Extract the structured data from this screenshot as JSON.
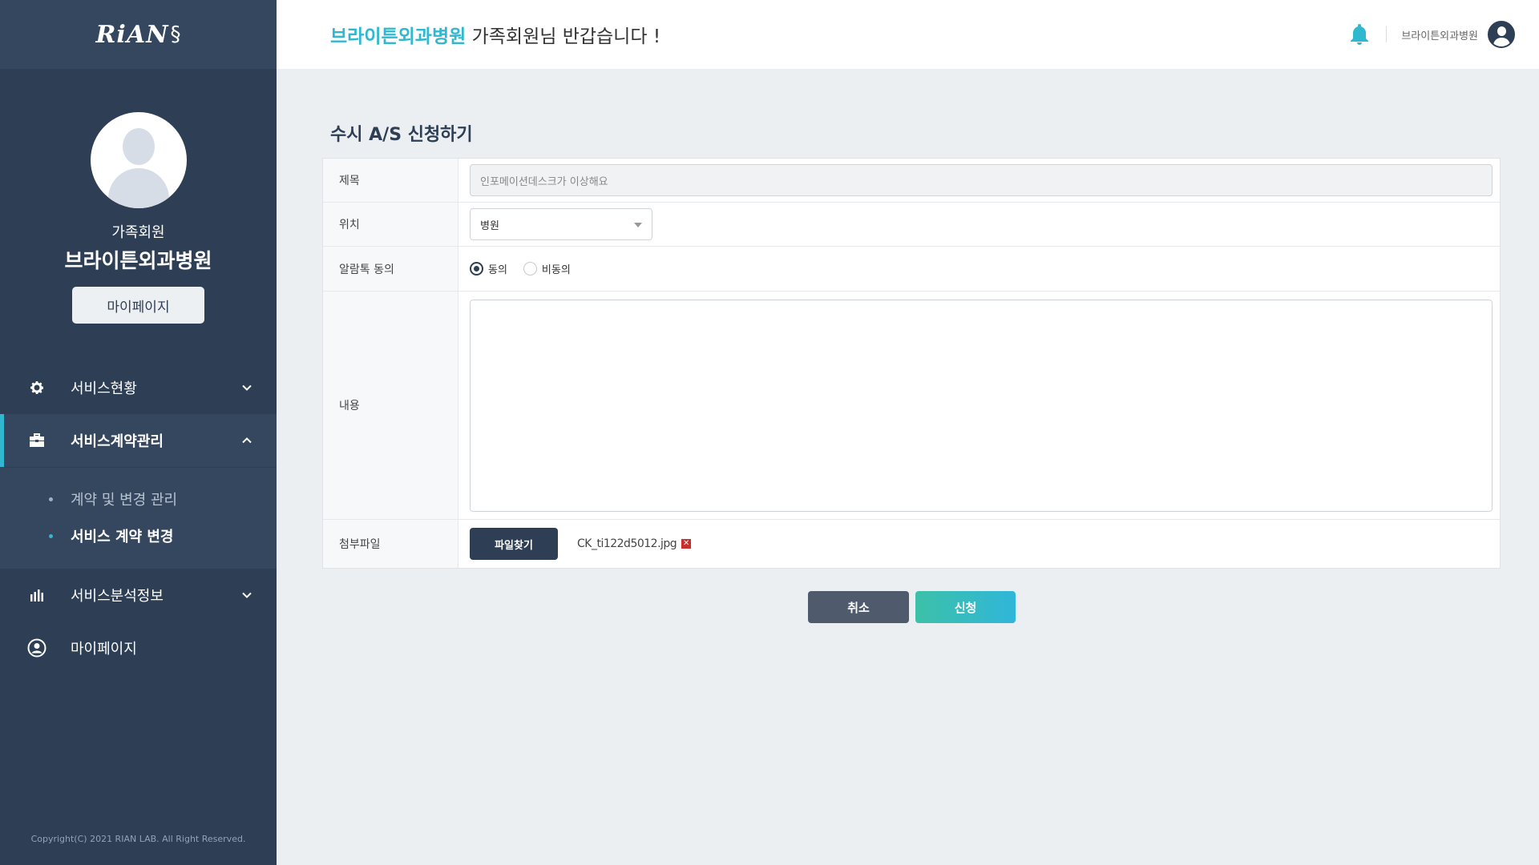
{
  "sidebar": {
    "logo": "RiAN",
    "member_type": "가족회원",
    "hospital_name": "브라이튼외과병원",
    "mypage_button": "마이페이지",
    "menu": [
      {
        "label": "서비스현황",
        "icon": "gear-icon"
      },
      {
        "label": "서비스계약관리",
        "icon": "briefcase-icon"
      },
      {
        "label": "서비스분석정보",
        "icon": "bar-chart-icon"
      },
      {
        "label": "마이페이지",
        "icon": "user-circle-icon"
      }
    ],
    "submenu": [
      {
        "label": "계약 및 변경 관리"
      },
      {
        "label": "서비스 계약 변경"
      }
    ],
    "copyright": "Copyright(C) 2021 RIAN LAB. All Right Reserved."
  },
  "header": {
    "hospital_highlight": "브라이튼외과병원",
    "welcome_suffix": " 가족회원님 반갑습니다 !",
    "user_name": "브라이튼외과병원"
  },
  "page": {
    "title": "수시 A/S 신청하기"
  },
  "form": {
    "title_label": "제목",
    "title_value": "인포메이션데스크가 이상해요",
    "location_label": "위치",
    "location_value": "병원",
    "agree_label": "알람톡 동의",
    "agree_options": [
      "동의",
      "비동의"
    ],
    "agree_selected": "동의",
    "content_label": "내용",
    "attach_label": "첨부파일",
    "file_button": "파일찾기",
    "file_name": "CK_ti122d5012.jpg"
  },
  "actions": {
    "cancel": "취소",
    "submit": "신청"
  },
  "colors": {
    "accent": "#2fb8d0",
    "sidebar": "#2d3e55",
    "delete": "#c9302c"
  }
}
